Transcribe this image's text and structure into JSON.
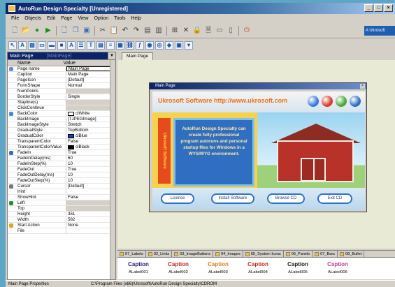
{
  "window": {
    "title": "AutoRun Design Specialty [Unregistered]",
    "min": "_",
    "max": "□",
    "close": "×"
  },
  "menu": [
    "File",
    "Objects",
    "Edit",
    "Page",
    "View",
    "Option",
    "Tools",
    "Help"
  ],
  "toolbar1": [
    {
      "name": "new-project-icon",
      "glyph": "🗋",
      "color": "#5a78b8"
    },
    {
      "name": "open-icon",
      "glyph": "📂",
      "color": "#d9a520"
    },
    {
      "name": "save-icon",
      "glyph": "●",
      "color": "#2f8a2f"
    },
    {
      "name": "run-icon",
      "glyph": "▶",
      "color": "#1e8a1e"
    },
    {
      "name": "new-page-icon",
      "glyph": "🗋",
      "color": "#3b6fb5"
    },
    {
      "name": "copy-page-icon",
      "glyph": "❐",
      "color": "#3b6fb5"
    },
    {
      "name": "page-properties-icon",
      "glyph": "▣",
      "color": "#3b6fb5"
    },
    {
      "name": "cut-icon",
      "glyph": "✂",
      "color": "#444"
    },
    {
      "name": "paste-icon",
      "glyph": "📋",
      "color": "#6a5a3a"
    },
    {
      "name": "undo-icon",
      "glyph": "↶",
      "color": "#333"
    },
    {
      "name": "redo-icon",
      "glyph": "↷",
      "color": "#333"
    },
    {
      "name": "bring-front-icon",
      "glyph": "▤",
      "color": "#444"
    },
    {
      "name": "send-back-icon",
      "glyph": "▥",
      "color": "#444"
    },
    {
      "name": "grid-icon",
      "glyph": "⊞",
      "color": "#444"
    },
    {
      "name": "delete-icon",
      "glyph": "✕",
      "color": "#333"
    },
    {
      "name": "lock-icon",
      "glyph": "🔒",
      "color": "#777"
    },
    {
      "name": "document-icon",
      "glyph": "🗎",
      "color": "#555"
    },
    {
      "name": "layout-icon",
      "glyph": "▭",
      "color": "#555"
    },
    {
      "name": "preview-icon",
      "glyph": "▯",
      "color": "#555"
    },
    {
      "name": "exit-icon",
      "glyph": "⏻",
      "color": "#d23a2a"
    }
  ],
  "toolbar2": [
    {
      "name": "select-icon",
      "glyph": "↖"
    },
    {
      "name": "label-tool-icon",
      "glyph": "A"
    },
    {
      "name": "image-tool-icon",
      "glyph": "▨"
    },
    {
      "name": "panel-tool-icon",
      "glyph": "▭"
    },
    {
      "name": "button-tool-icon",
      "glyph": "▬"
    },
    {
      "name": "shape-tool-icon",
      "glyph": "■"
    },
    {
      "name": "text-tool-icon",
      "glyph": "A"
    },
    {
      "name": "memo-tool-icon",
      "glyph": "☰"
    },
    {
      "name": "text-block-tool-icon",
      "glyph": "T"
    },
    {
      "name": "edit-tool-icon",
      "glyph": "▤"
    },
    {
      "name": "list-tool-icon",
      "glyph": "≡"
    },
    {
      "name": "grid-tool-icon",
      "glyph": "▦"
    },
    {
      "name": "link-tool-icon",
      "glyph": "⛓"
    },
    {
      "name": "flash-tool-icon",
      "glyph": "ƒ"
    },
    {
      "name": "media-tool-icon",
      "glyph": "◉"
    },
    {
      "name": "browser-tool-icon",
      "glyph": "◎"
    },
    {
      "name": "web-tool-icon",
      "glyph": "◈"
    },
    {
      "name": "pdf-tool-icon",
      "glyph": "▣"
    },
    {
      "name": "dropdown-tool-icon",
      "glyph": "▾"
    }
  ],
  "toolbar_right_label": "A Ukrosoft",
  "object_selector": {
    "name": "Main Page",
    "type": "[MainPage]"
  },
  "grid_headers": {
    "name": "Name",
    "value": "Value"
  },
  "properties": [
    {
      "name": "Page name",
      "value": "Main Page",
      "state": "sel",
      "icon": "#6a8fd0"
    },
    {
      "name": "Caption",
      "value": "Main Page"
    },
    {
      "name": "PageIcon",
      "value": "[Default]"
    },
    {
      "name": "FormShape",
      "value": "Normal"
    },
    {
      "name": "NumPoints",
      "value": "",
      "state": "dis"
    },
    {
      "name": "BorderStyle",
      "value": "Single"
    },
    {
      "name": "Stayline(s)",
      "value": "",
      "state": "dis"
    },
    {
      "name": "ClickContinue",
      "value": "",
      "state": "dis"
    },
    {
      "name": "BackColor",
      "value": "clWhite",
      "swatch": "#ffffff",
      "icon": "#3a8fd2"
    },
    {
      "name": "BackImage",
      "value": "[TJPEGImage]"
    },
    {
      "name": "BackImageStyle",
      "value": "Stretch"
    },
    {
      "name": "GradualStyle",
      "value": "TopBottom"
    },
    {
      "name": "GradualColor",
      "value": "clBlue",
      "swatch": "#1b3fae"
    },
    {
      "name": "TransparentColor",
      "value": "False"
    },
    {
      "name": "TransparentColorValue",
      "value": "clBlack",
      "swatch": "#000000"
    },
    {
      "name": "FadeIn",
      "value": "True",
      "icon": "#3b6fb5"
    },
    {
      "name": "FadeInDelay(ms)",
      "value": "60"
    },
    {
      "name": "FadeInStep(%)",
      "value": "10"
    },
    {
      "name": "FadeOut",
      "value": "True"
    },
    {
      "name": "FadeOutDelay(ms)",
      "value": "10"
    },
    {
      "name": "FadeOutStep(%)",
      "value": "10"
    },
    {
      "name": "Cursor",
      "value": "[Default]",
      "icon": "#777777"
    },
    {
      "name": "Hint",
      "value": ""
    },
    {
      "name": "ShowHint",
      "value": "False"
    },
    {
      "name": "Left",
      "value": "",
      "state": "dis",
      "icon": "#2f8a2f"
    },
    {
      "name": "Top",
      "value": "",
      "state": "dis"
    },
    {
      "name": "Height",
      "value": "351"
    },
    {
      "name": "Width",
      "value": "582"
    },
    {
      "name": "Start Action",
      "value": "None",
      "icon": "#d9a520"
    },
    {
      "name": "File",
      "value": ""
    }
  ],
  "design_tab": "Main Page",
  "page_window": {
    "title": "Main Page",
    "close": "×"
  },
  "page": {
    "brand": "Ukrosoft Software http://www.ukrosoft.com",
    "vertical_text": "Ukrosoft Software",
    "body_text": "AutoRun Design Specialty can create fully professional program autoruns and personal startup files for Windows in a WYSIWYG environment.",
    "buttons": [
      "License",
      "Install Software",
      "Browse CD",
      "Exit CD"
    ],
    "balls": [
      {
        "color": "#3a7ad6",
        "name": "home-ball-icon"
      },
      {
        "color": "#d83a2a",
        "name": "info-ball-icon"
      },
      {
        "color": "#4aa83a",
        "name": "web-ball-icon"
      },
      {
        "color": "#2f6ec0",
        "name": "mail-ball-icon"
      }
    ]
  },
  "gallery": {
    "tabs": [
      "07_Labels",
      "02_Links",
      "03_ImageButtons",
      "04_Images",
      "05_System Icons",
      "06_Panels",
      "07_Bars",
      "08_Bullet"
    ],
    "items": [
      {
        "label": "ALabel001",
        "caption": "Caption",
        "color": "#2a1a6a"
      },
      {
        "label": "ALabel002",
        "caption": "Caption",
        "color": "#c8281a"
      },
      {
        "label": "ALabel003",
        "caption": "Caption",
        "color": "#e87a1a"
      },
      {
        "label": "ALabel004",
        "caption": "Caption",
        "color": "#c8281a"
      },
      {
        "label": "ALabel005",
        "caption": "Caption",
        "color": "#1a1a1a"
      },
      {
        "label": "ALabel006",
        "caption": "Caption",
        "color": "#c83a8a"
      }
    ]
  },
  "status": {
    "left": "Main Page Properties",
    "right": "C:\\Program Files (x86)\\Ukrosoft\\AutoRun Design Specialty\\CDROM"
  }
}
